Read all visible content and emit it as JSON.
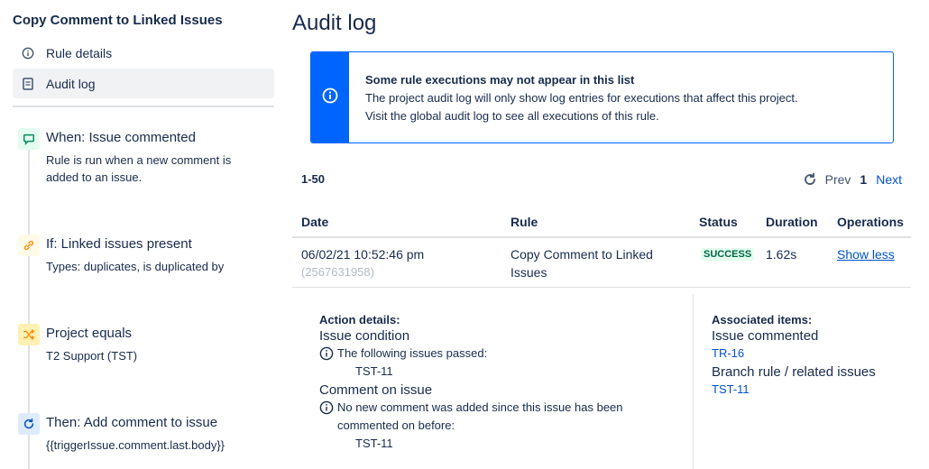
{
  "sidebar": {
    "rule_title": "Copy Comment to Linked Issues",
    "nav": [
      {
        "label": "Rule details",
        "icon": "info-icon"
      },
      {
        "label": "Audit log",
        "icon": "document-icon",
        "active": true
      }
    ],
    "components": [
      {
        "title": "When: Issue commented",
        "desc": "Rule is run when a new comment is added to an issue.",
        "icon": "comment-icon",
        "color": "#e3fcef"
      },
      {
        "title": "If: Linked issues present",
        "desc": "Types: duplicates, is duplicated by",
        "icon": "link-icon",
        "color": "#fffae6"
      },
      {
        "title": "Project equals",
        "desc": "T2 Support (TST)",
        "icon": "shuffle-icon",
        "color": "#fff0b3"
      },
      {
        "title": "Then: Add comment to issue",
        "desc": "{{triggerIssue.comment.last.body}}",
        "icon": "refresh-icon",
        "color": "#deebff"
      }
    ]
  },
  "main": {
    "title": "Audit log",
    "banner": {
      "title": "Some rule executions may not appear in this list",
      "line1": "The project audit log will only show log entries for executions that affect this project.",
      "line2": "Visit the global audit log to see all executions of this rule."
    },
    "range": "1-50",
    "pager": {
      "prev": "Prev",
      "page": "1",
      "next": "Next"
    },
    "columns": {
      "date": "Date",
      "rule": "Rule",
      "status": "Status",
      "duration": "Duration",
      "operations": "Operations"
    },
    "row": {
      "date": "06/02/21 10:52:46 pm",
      "id": "(2567631958)",
      "rule": "Copy Comment to Linked Issues",
      "status": "SUCCESS",
      "duration": "1.62s",
      "operation": "Show less"
    },
    "details": {
      "action_label": "Action details:",
      "action1_heading": "Issue condition",
      "action1_text": "The following issues passed:",
      "action1_issue": "TST-11",
      "action2_heading": "Comment on issue",
      "action2_text": "No new comment was added since this issue has been commented on before:",
      "action2_issue": "TST-11",
      "assoc_label": "Associated items:",
      "assoc1_heading": "Issue commented",
      "assoc1_link": "TR-16",
      "assoc2_heading": "Branch rule / related issues",
      "assoc2_link": "TST-11"
    }
  },
  "colors": {
    "brand": "#0065ff",
    "success_bg": "#e3fcef",
    "success_text": "#006644",
    "link": "#0052cc"
  }
}
